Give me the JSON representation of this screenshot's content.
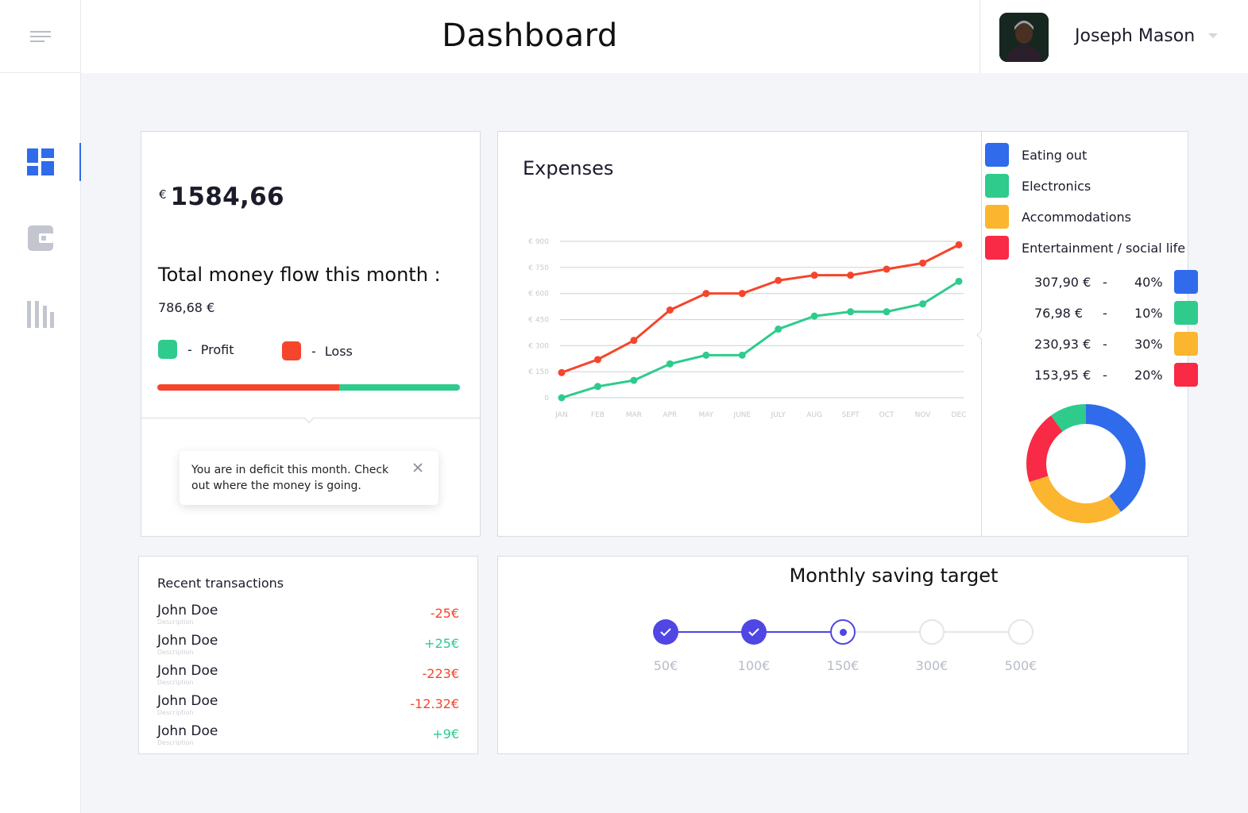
{
  "header": {
    "title": "Dashboard",
    "user_name": "Joseph Mason"
  },
  "sidebar": {
    "items": [
      {
        "icon": "dashboard-icon",
        "active": true
      },
      {
        "icon": "wallet-icon",
        "active": false
      },
      {
        "icon": "bars-icon",
        "active": false
      }
    ]
  },
  "balance": {
    "currency": "€",
    "amount": "1584,66",
    "money_flow_label": "Total money flow this month :",
    "money_flow_value": "786,68 €",
    "legend": [
      {
        "label": "Profit",
        "color": "#2ecb8d"
      },
      {
        "label": "Loss",
        "color": "#f5452c"
      }
    ],
    "loss_fraction": 0.6,
    "notice": "You are in deficit this month. Check out where the money is going."
  },
  "expenses": {
    "title": "Expenses",
    "categories": [
      {
        "label": "Eating out",
        "color": "#2f6bea",
        "value": "307,90 €",
        "percent": "40%"
      },
      {
        "label": "Electronics",
        "color": "#2ecb8d",
        "value": "76,98 €",
        "percent": "10%"
      },
      {
        "label": "Accommodations",
        "color": "#fbb52e",
        "value": "230,93 €",
        "percent": "30%"
      },
      {
        "label": "Entertainment / social life",
        "color": "#f82a45",
        "value": "153,95 €",
        "percent": "20%"
      }
    ],
    "separator": "-"
  },
  "chart_data": [
    {
      "type": "line",
      "title": "",
      "categories": [
        "JAN",
        "FEB",
        "MAR",
        "APR",
        "MAY",
        "JUNE",
        "JULY",
        "AUG",
        "SEPT",
        "OCT",
        "NOV",
        "DEC"
      ],
      "y_ticks": [
        "0",
        "€ 150",
        "€ 300",
        "€ 450",
        "€ 600",
        "€ 750",
        "€ 900"
      ],
      "ylim": [
        0,
        900
      ],
      "grid": true,
      "series": [
        {
          "color": "#f5452c",
          "values": [
            145,
            220,
            330,
            505,
            600,
            600,
            675,
            705,
            705,
            740,
            775,
            880
          ]
        },
        {
          "color": "#2ecb8d",
          "values": [
            0,
            65,
            100,
            195,
            245,
            245,
            395,
            470,
            495,
            495,
            540,
            670
          ]
        }
      ]
    },
    {
      "type": "pie",
      "donut": true,
      "slices": [
        {
          "label": "Eating out",
          "value": 40,
          "color": "#2f6bea"
        },
        {
          "label": "Accommodations",
          "value": 30,
          "color": "#fbb52e"
        },
        {
          "label": "Entertainment / social life",
          "value": 20,
          "color": "#f82a45"
        },
        {
          "label": "Electronics",
          "value": 10,
          "color": "#2ecb8d"
        }
      ]
    }
  ],
  "transactions": {
    "title": "Recent transactions",
    "rows": [
      {
        "name": "John Doe",
        "desc": "Description",
        "amount": "-25€",
        "color": "#f5452c"
      },
      {
        "name": "John Doe",
        "desc": "Description",
        "amount": "+25€",
        "color": "#2ecb8d"
      },
      {
        "name": "John Doe",
        "desc": "Description",
        "amount": "-223€",
        "color": "#f5452c"
      },
      {
        "name": "John Doe",
        "desc": "Description",
        "amount": "-12.32€",
        "color": "#f5452c"
      },
      {
        "name": "John Doe",
        "desc": "Description",
        "amount": "+9€",
        "color": "#2ecb8d"
      }
    ]
  },
  "saving": {
    "title": "Monthly saving target",
    "steps": [
      {
        "label": "50€",
        "state": "done"
      },
      {
        "label": "100€",
        "state": "done"
      },
      {
        "label": "150€",
        "state": "current"
      },
      {
        "label": "300€",
        "state": "todo"
      },
      {
        "label": "500€",
        "state": "todo"
      }
    ],
    "accent": "#5046e4"
  }
}
